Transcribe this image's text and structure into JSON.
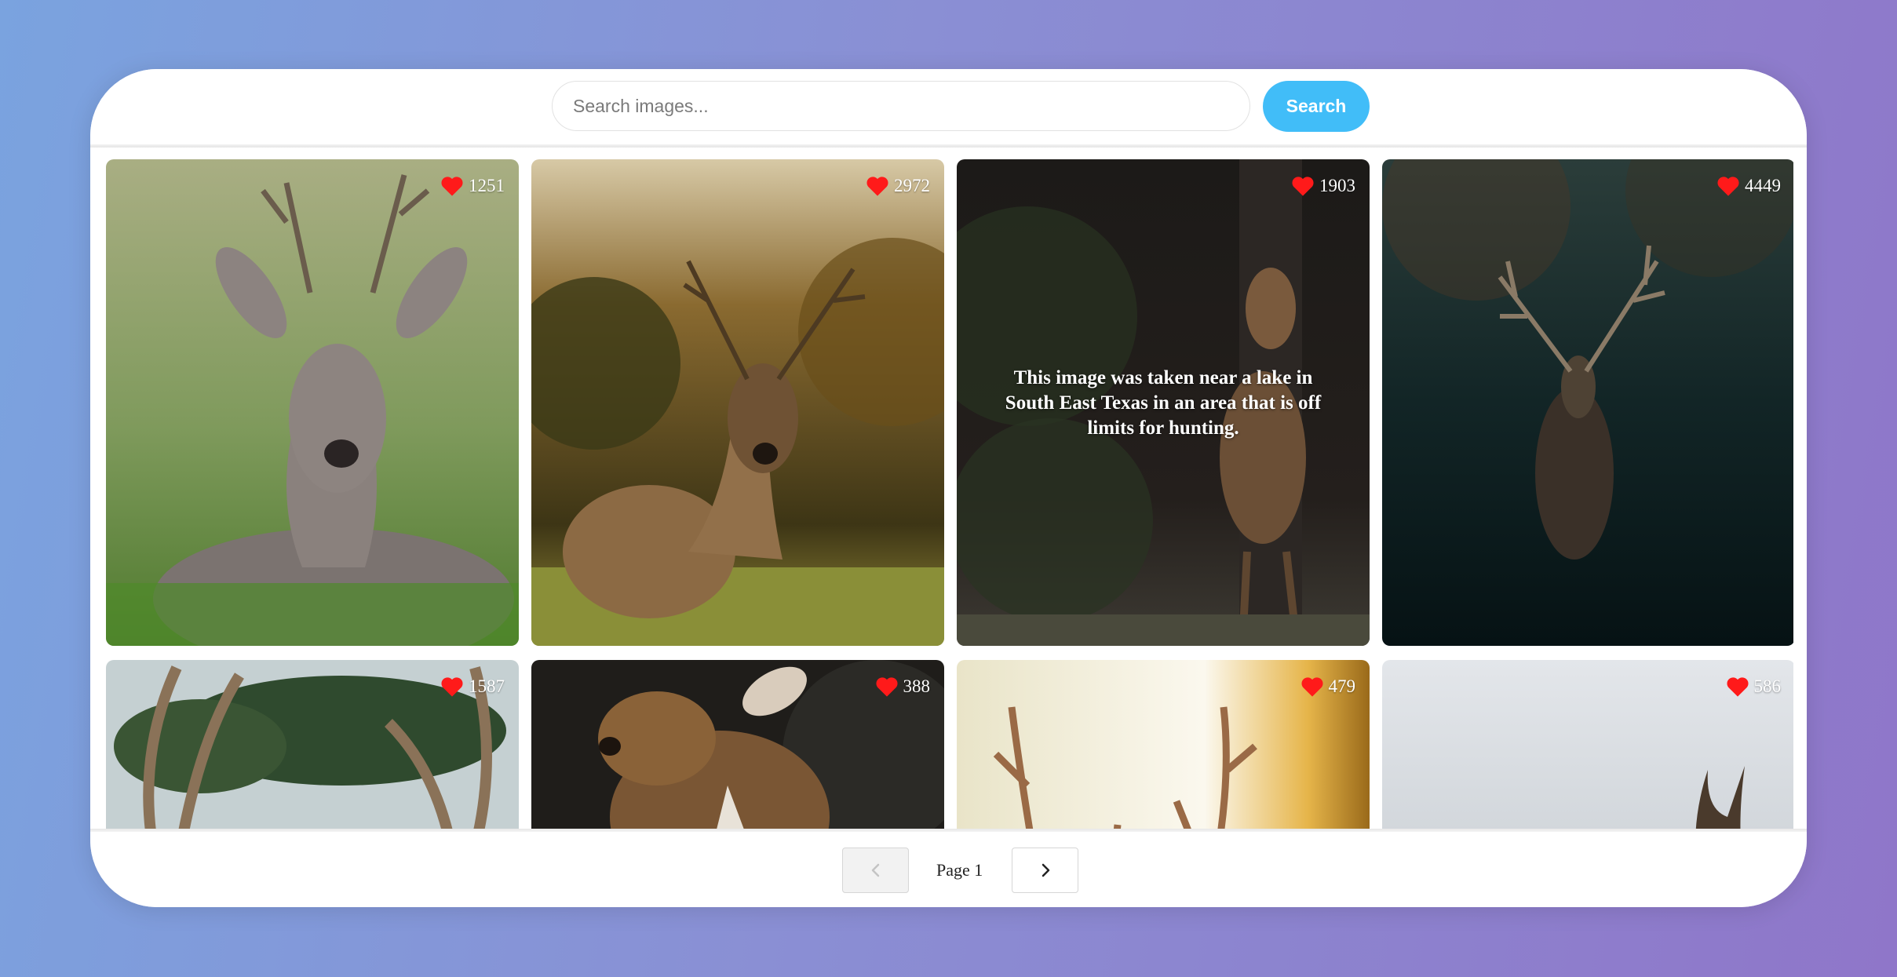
{
  "search": {
    "placeholder": "Search images...",
    "value": "",
    "button_label": "Search"
  },
  "gallery": {
    "cards": [
      {
        "likes": "1251",
        "caption": ""
      },
      {
        "likes": "2972",
        "caption": ""
      },
      {
        "likes": "1903",
        "caption": "This image was taken near a lake in South East Texas in an area that is off limits for hunting."
      },
      {
        "likes": "4449",
        "caption": ""
      },
      {
        "likes": "1587",
        "caption": ""
      },
      {
        "likes": "388",
        "caption": ""
      },
      {
        "likes": "479",
        "caption": ""
      },
      {
        "likes": "586",
        "caption": ""
      }
    ]
  },
  "pagination": {
    "page_label": "Page 1",
    "prev_icon": "chevron-left-icon",
    "next_icon": "chevron-right-icon"
  },
  "colors": {
    "accent": "#41bdf8",
    "heart": "#ff1a1a"
  }
}
